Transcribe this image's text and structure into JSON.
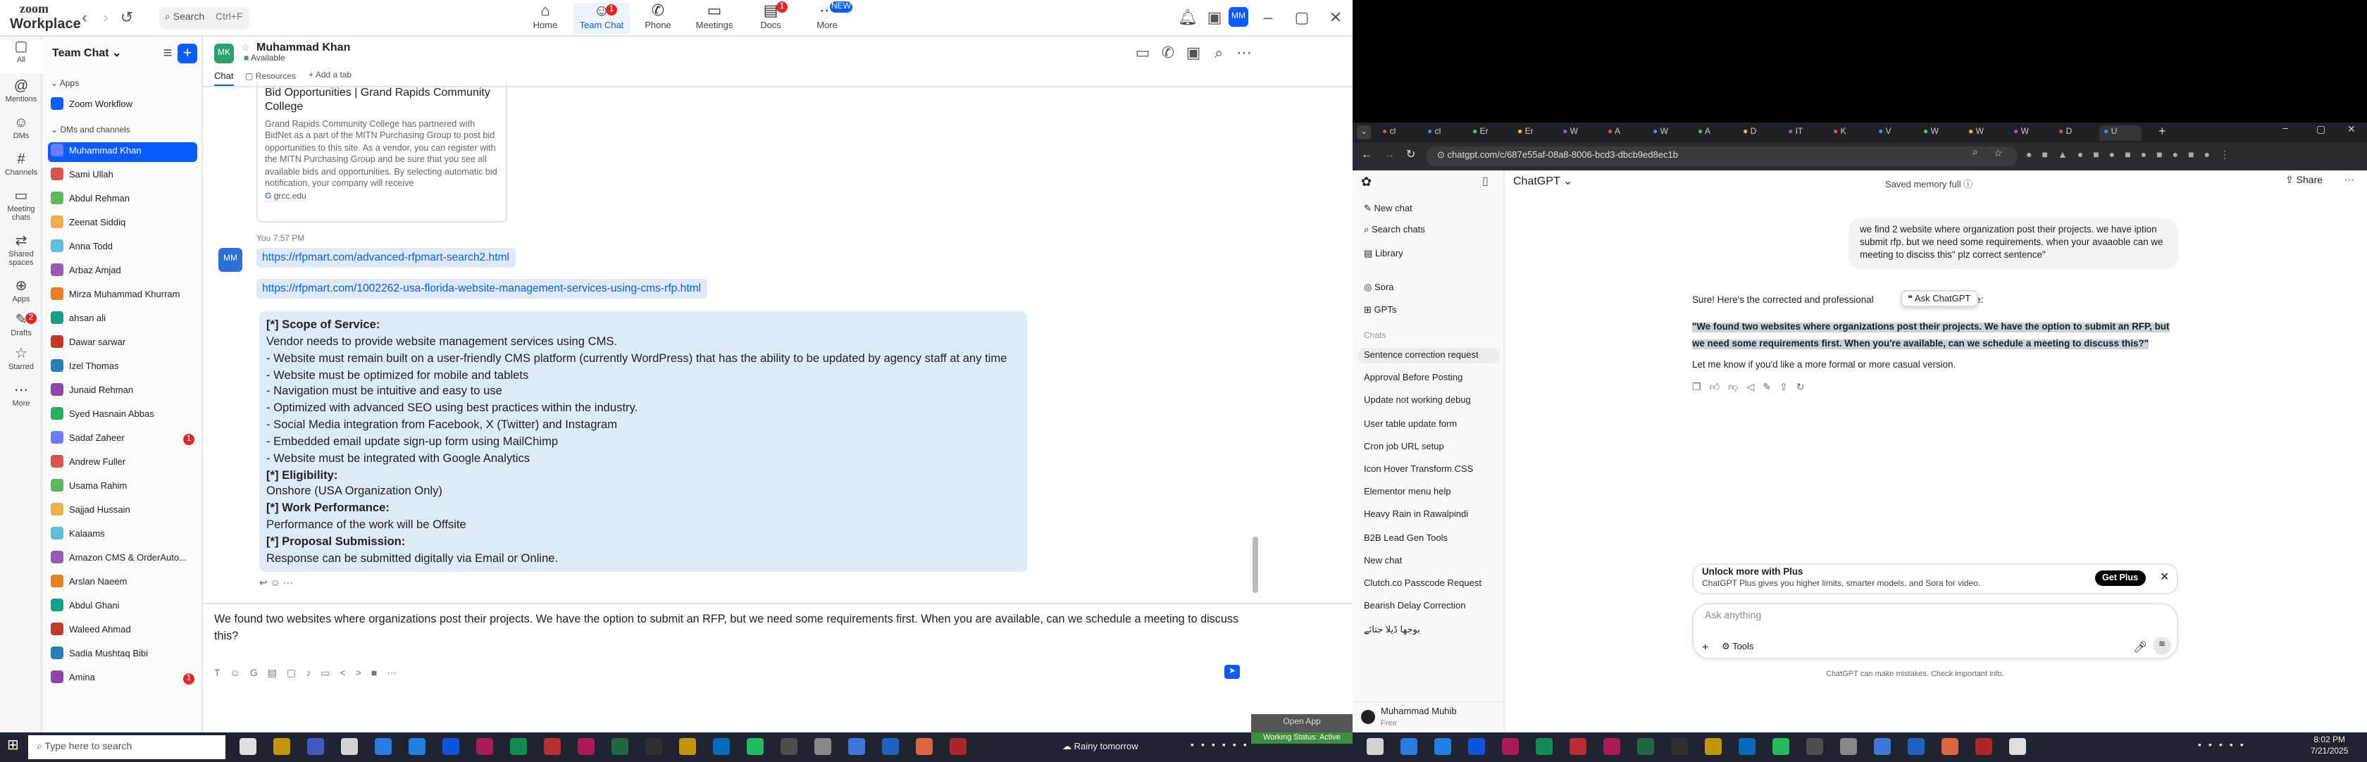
{
  "zoom": {
    "logo_top": "zoom",
    "logo_bottom": "Workplace",
    "search": {
      "label": "Search",
      "shortcut": "Ctrl+F"
    },
    "nav": [
      {
        "label": "Home"
      },
      {
        "label": "Team Chat",
        "badge": "1"
      },
      {
        "label": "Phone"
      },
      {
        "label": "Meetings"
      },
      {
        "label": "Docs",
        "badge": "1"
      },
      {
        "label": "More",
        "badge": "NEW"
      }
    ],
    "rail": [
      {
        "label": "All"
      },
      {
        "label": "Mentions"
      },
      {
        "label": "DMs"
      },
      {
        "label": "Channels"
      },
      {
        "label": "Meeting chats"
      },
      {
        "label": "Shared spaces"
      },
      {
        "label": "Apps"
      },
      {
        "label": "Drafts",
        "badge": "2"
      },
      {
        "label": "Starred"
      },
      {
        "label": "More"
      }
    ],
    "list_title": "Team Chat",
    "apps_section": "Apps",
    "apps": [
      "Zoom Workflow"
    ],
    "dm_section": "DMs and channels",
    "dms": [
      "Muhammad Khan",
      "Sami Ullah",
      "Abdul Rehman",
      "Zeenat Siddiq",
      "Anna Todd",
      "Arbaz Amjad",
      "Mirza Muhammad Khurram",
      "ahsan ali",
      "Dawar sarwar",
      "Izel Thomas",
      "Junaid Rehman",
      "Syed Hasnain Abbas",
      "Sadaf Zaheer",
      "Andrew Fuller",
      "Usama Rahim",
      "Sajjad Hussain",
      "Kalaams",
      "Amazon CMS & OrderAuto...",
      "Arslan Naeem",
      "Abdul Ghani",
      "Waleed Ahmad",
      "Sadia Mushtaq Bibi",
      "Amina"
    ],
    "dm_badges": {
      "12": "1",
      "22": "1"
    },
    "chat": {
      "name": "Muhammad Khan",
      "status": "Available",
      "avatar": "MK",
      "tabs": [
        "Chat",
        "Resources",
        "Add a tab"
      ],
      "card_title": "Bid Opportunities | Grand Rapids Community College",
      "card_body": "Grand Rapids Community College has partnered with BidNet as a part of the MITN Purchasing Group to post bid opportunities to this site. As a vendor, you can register with the MITN Purchasing Group and be sure that you see all available bids and opportunities. By selecting automatic bid notification, your company will receive",
      "card_domain": "grcc.edu",
      "you_label": "You",
      "time": "7:57 PM",
      "my_avatar": "MM",
      "link1": "https://rfpmart.com/advanced-rfpmart-search2.html",
      "link2": "https://rfpmart.com/1002262-usa-florida-website-management-services-using-cms-rfp.html",
      "scope": [
        {
          "b": true,
          "t": "[*] Scope of Service:"
        },
        {
          "t": "Vendor needs to provide website management services using CMS."
        },
        {
          "t": "- Website must remain built on a user-friendly CMS platform (currently WordPress) that has the ability to be updated by agency staff at any time"
        },
        {
          "t": "- Website must be optimized for mobile and tablets"
        },
        {
          "t": "- Navigation must be intuitive and easy to use"
        },
        {
          "t": "- Optimized with advanced SEO using best practices within the industry."
        },
        {
          "t": "- Social Media integration from Facebook, X (Twitter) and Instagram"
        },
        {
          "t": "- Embedded email update sign-up form using MailChimp"
        },
        {
          "t": "- Website must be integrated with Google Analytics"
        },
        {
          "b": true,
          "t": "[*] Eligibility:"
        },
        {
          "t": "Onshore (USA Organization Only)"
        },
        {
          "b": true,
          "t": "[*] Work Performance:"
        },
        {
          "t": "Performance of the work will be Offsite"
        },
        {
          "b": true,
          "t": "[*] Proposal Submission:"
        },
        {
          "t": "Response can be submitted digitally via Email or Online."
        }
      ],
      "compose": "We found two websites where organizations post their projects. We have the option to submit an RFP, but we need some requirements first. When you are available, can we schedule a meeting to discuss this?"
    }
  },
  "chrome": {
    "url": "chatgpt.com/c/687e55af-08a8-8006-bcd3-dbcb9ed8ec1b",
    "tabs": [
      "cl",
      "cl",
      "Er",
      "Er",
      "W",
      "A",
      "W",
      "A",
      "D",
      "IT",
      "K",
      "V",
      "W",
      "W",
      "W",
      "D",
      "U"
    ],
    "sidebar": {
      "items": [
        "New chat",
        "Search chats",
        "Library",
        "Sora",
        "GPTs"
      ],
      "chats_label": "Chats",
      "chats": [
        "Sentence correction request",
        "Approval Before Posting",
        "Update not working debug",
        "User table update form",
        "Cron job URL setup",
        "Icon Hover Transform CSS",
        "Elementor menu help",
        "Heavy Rain in Rawalpindi",
        "B2B Lead Gen Tools",
        "New chat",
        "Clutch.co Passcode Request",
        "Bearish Delay Correction",
        "بوجھا ڈیلا جتائے"
      ],
      "user": "Muhammad Muhib",
      "plan": "Free"
    },
    "main": {
      "model": "ChatGPT",
      "memory": "Saved memory full",
      "share": "Share",
      "user_msg": "we find 2 website where organization post their projects. we have iption submit rfp. but we need some  requirements.  when your avaaoble can we meeting to disciss this\" plz correct sentence\"",
      "reply_intro": "Sure! Here's the corrected and professional",
      "reply_intro_end": "tence:",
      "ask_chip": "Ask ChatGPT",
      "quoted": "\"We found two websites where organizations post their projects. We have the option to submit an RFP, but we need some requirements first. When you're available, can we schedule a meeting to discuss this?\"",
      "reply_outro": "Let me know if you'd like a more formal or more casual version.",
      "promo_title": "Unlock more with Plus",
      "promo_body": "ChatGPT Plus gives you higher limits, smarter models, and Sora for video.",
      "promo_btn": "Get Plus",
      "input_placeholder": "Ask anything",
      "tools": "Tools",
      "footer": "ChatGPT can make mistakes. Check important info."
    }
  },
  "taskbar": {
    "search": "Type here to search",
    "weather": "Rainy tomorrow",
    "time": "8:02 PM",
    "date": "7/21/2025",
    "toast1": "Open App",
    "toast2": "Working Status: Active"
  }
}
